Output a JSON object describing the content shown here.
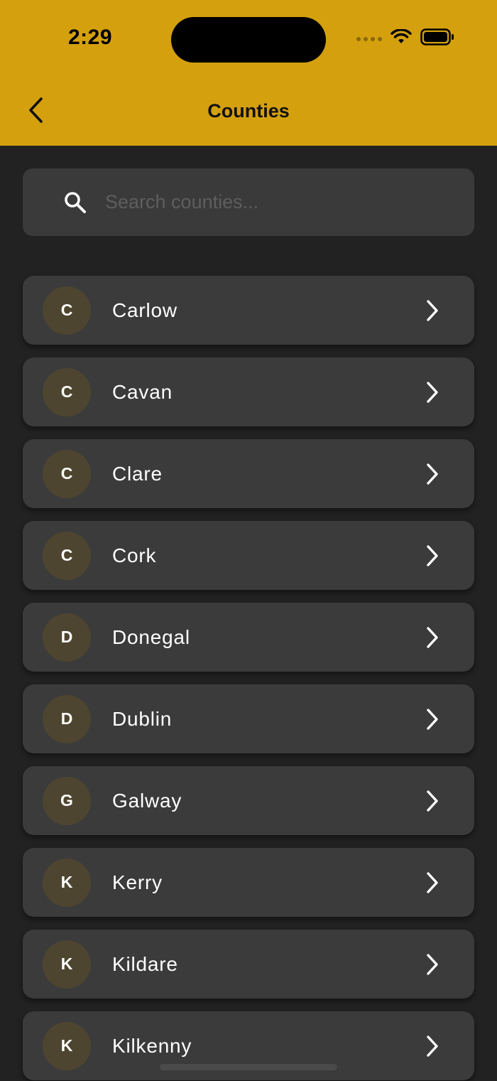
{
  "status_bar": {
    "time": "2:29"
  },
  "header": {
    "title": "Counties",
    "background": "#D4A00E",
    "back_icon": "chevron-left-icon"
  },
  "search": {
    "value": "",
    "placeholder": "Search counties...",
    "icon": "search-icon"
  },
  "counties": [
    {
      "initial": "C",
      "name": "Carlow"
    },
    {
      "initial": "C",
      "name": "Cavan"
    },
    {
      "initial": "C",
      "name": "Clare"
    },
    {
      "initial": "C",
      "name": "Cork"
    },
    {
      "initial": "D",
      "name": "Donegal"
    },
    {
      "initial": "D",
      "name": "Dublin"
    },
    {
      "initial": "G",
      "name": "Galway"
    },
    {
      "initial": "K",
      "name": "Kerry"
    },
    {
      "initial": "K",
      "name": "Kildare"
    },
    {
      "initial": "K",
      "name": "Kilkenny"
    }
  ],
  "colors": {
    "page_background": "#222222",
    "card_background": "#3B3B3B",
    "avatar_background": "#4E4530",
    "text": "#FFFFFF"
  }
}
